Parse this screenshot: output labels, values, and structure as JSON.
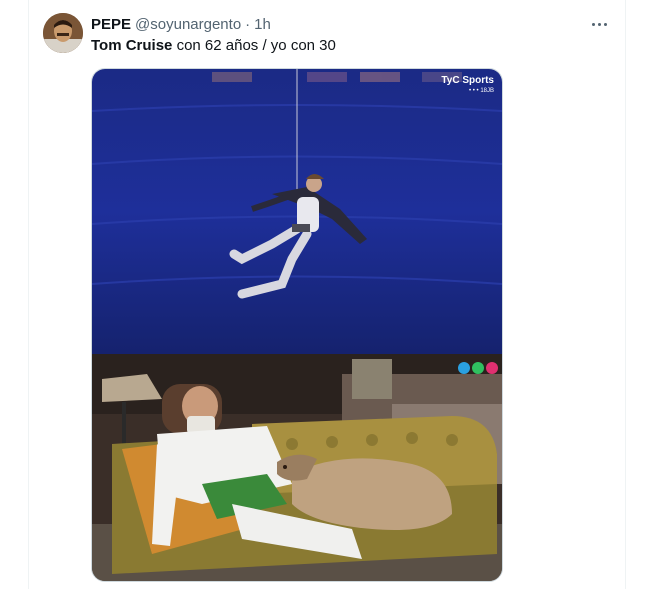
{
  "tweet": {
    "author_name": "PEPE",
    "author_handle": "@soyunargento",
    "separator": "·",
    "time": "1h",
    "text_bold": "Tom Cruise",
    "text_rest": " con 62 años / yo con 30"
  },
  "media": {
    "top_watermark": "TyC Sports",
    "top_watermark_sub": "• • • 18JB",
    "colors": {
      "top_bg": "#1a2b8c",
      "bottom_floor": "#5a5046"
    }
  },
  "icons": {
    "more": "more-horizontal-icon",
    "avatar": "avatar"
  }
}
